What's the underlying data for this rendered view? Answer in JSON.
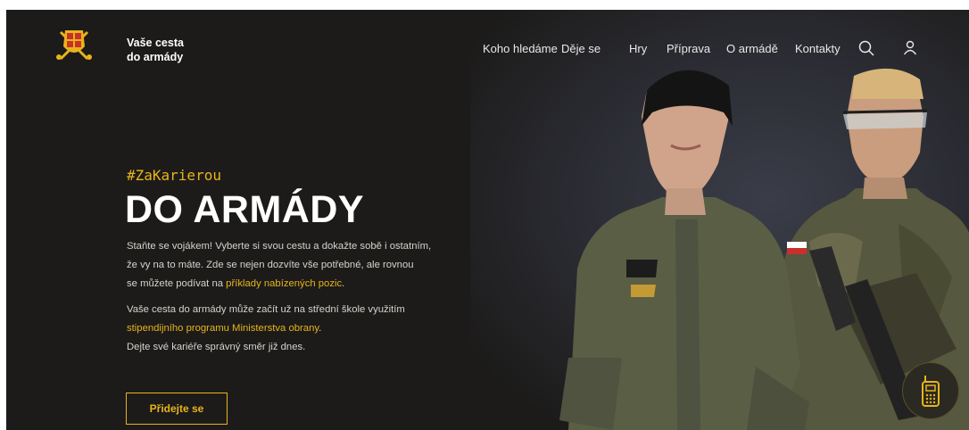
{
  "header": {
    "brand_line1": "Vaše cesta",
    "brand_line2": "do armády",
    "nav": [
      "Koho hledáme",
      "Děje se",
      "Hry",
      "Příprava",
      "O armádě",
      "Kontakty"
    ]
  },
  "hero": {
    "hashtag": "#ZaKarierou",
    "title": "DO ARMÁDY",
    "p1_line1": "Staňte se vojákem! Vyberte si svou cestu a dokažte sobě i ostatním,",
    "p1_line2": "že vy na to máte. Zde se nejen dozvíte vše potřebné, ale rovnou",
    "p1_line3_pre": "se můžete podívat na ",
    "p1_link": "příklady nabízených pozic",
    "p1_line3_post": ".",
    "p2_line1": "Vaše cesta do armády může začít už na střední škole využitím",
    "p2_link": "stipendijního programu Ministerstva obrany",
    "p2_link_post": ".",
    "p2_line3": "Dejte své kariéře správný směr již dnes.",
    "cta_label": "Přidejte se"
  },
  "colors": {
    "accent": "#e8b419",
    "background": "#1c1b1a"
  },
  "icons": [
    "army-emblem-icon",
    "search-icon",
    "user-icon",
    "walkie-talkie-icon"
  ]
}
